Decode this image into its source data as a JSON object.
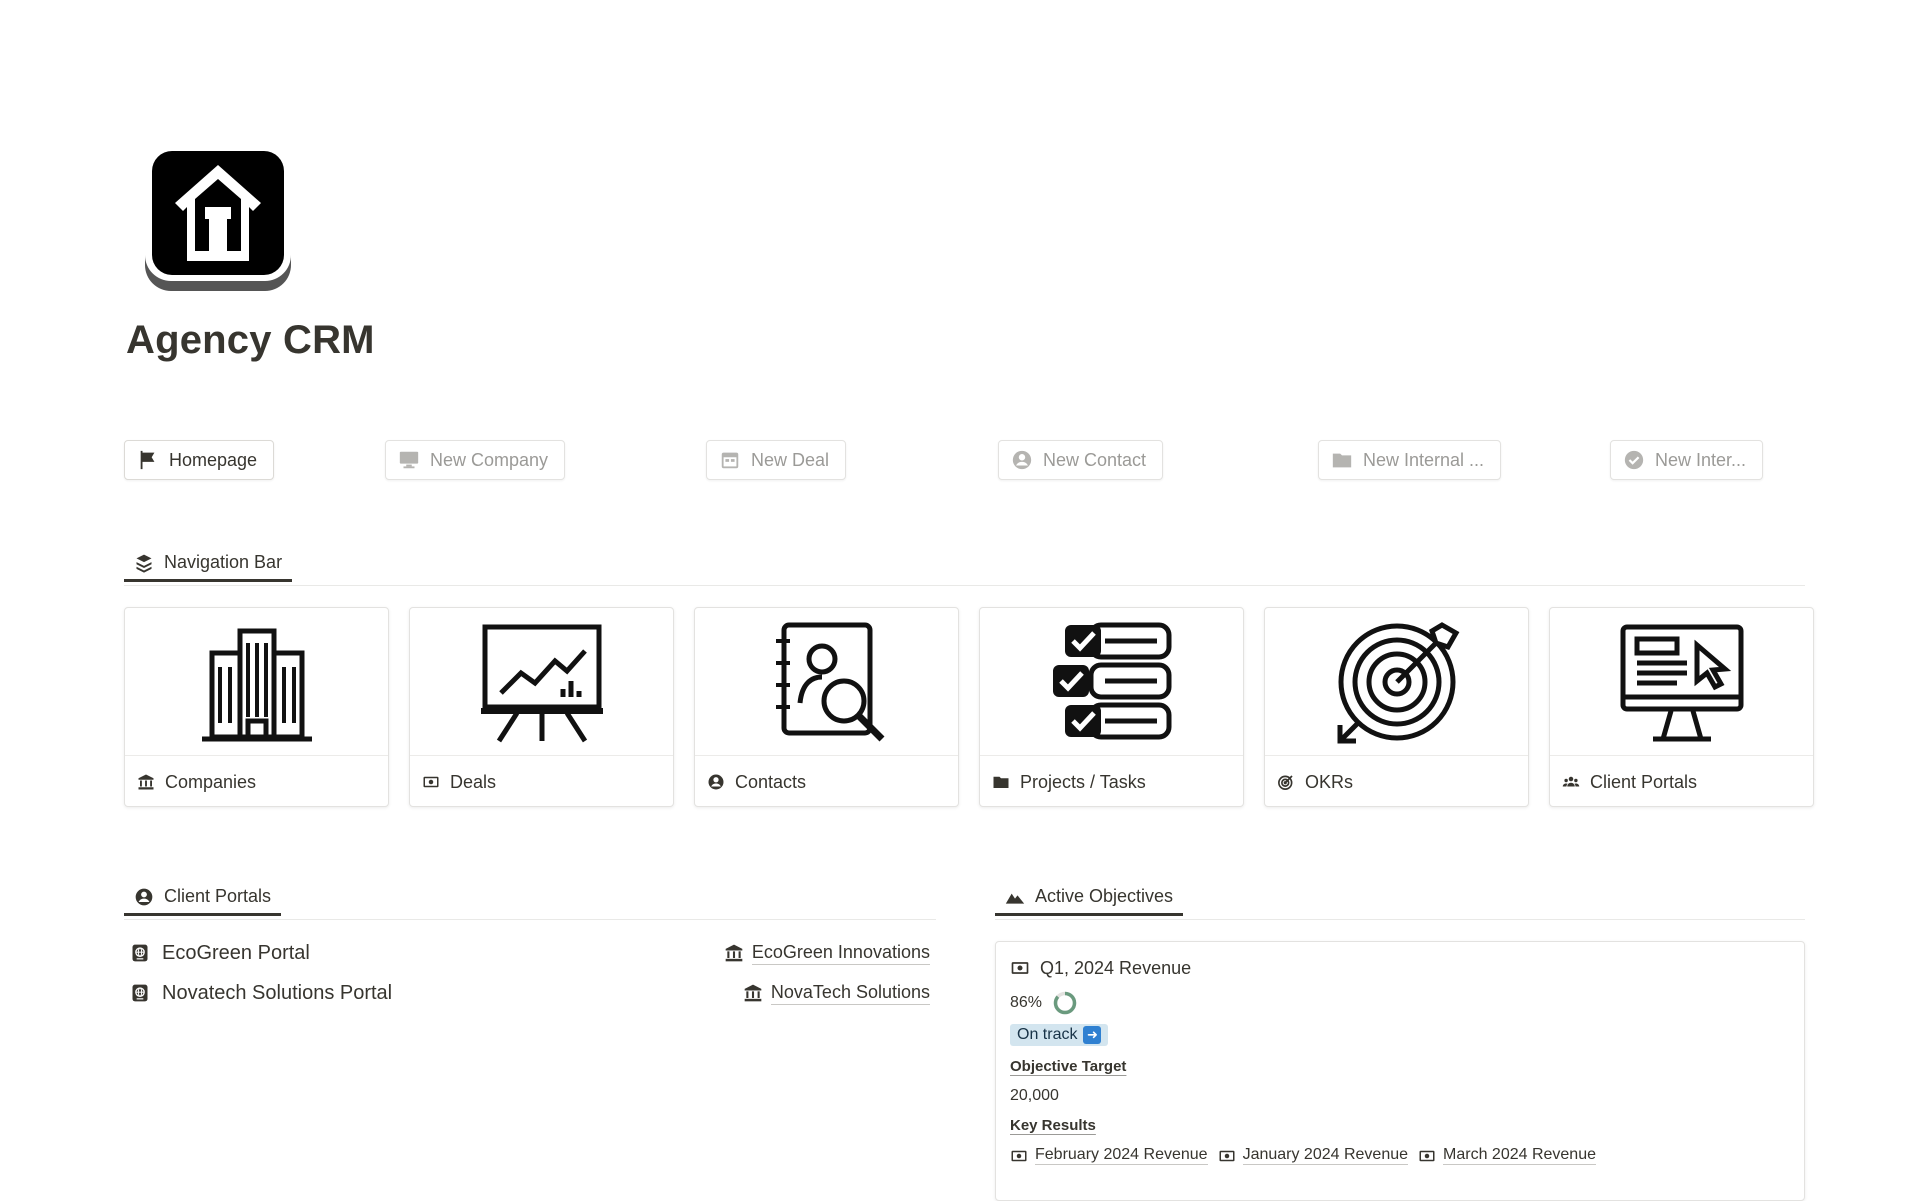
{
  "page": {
    "title": "Agency CRM",
    "icon": "house-icon"
  },
  "buttons": [
    {
      "label": "Homepage",
      "icon": "flag-icon",
      "primary": true
    },
    {
      "label": "New Company",
      "icon": "monitor-icon"
    },
    {
      "label": "New Deal",
      "icon": "calendar-icon"
    },
    {
      "label": "New Contact",
      "icon": "user-circle-icon"
    },
    {
      "label": "New Internal ...",
      "icon": "folder-icon"
    },
    {
      "label": "New Inter...",
      "icon": "check-circle-icon"
    }
  ],
  "navigation": {
    "tab_label": "Navigation Bar",
    "tab_icon": "layers-icon",
    "cards": [
      {
        "label": "Companies",
        "icon": "bank-icon",
        "cover": "buildings-icon"
      },
      {
        "label": "Deals",
        "icon": "money-icon",
        "cover": "chart-board-icon"
      },
      {
        "label": "Contacts",
        "icon": "user-circle-icon",
        "cover": "contact-search-icon"
      },
      {
        "label": "Projects / Tasks",
        "icon": "folder-icon",
        "cover": "checklist-icon"
      },
      {
        "label": "OKRs",
        "icon": "target-icon",
        "cover": "target-arrow-icon"
      },
      {
        "label": "Client Portals",
        "icon": "group-icon",
        "cover": "monitor-cursor-icon"
      }
    ]
  },
  "client_portals": {
    "tab_label": "Client Portals",
    "tab_icon": "user-circle-icon",
    "items": [
      {
        "name": "EcoGreen Portal",
        "company": "EcoGreen Innovations"
      },
      {
        "name": "Novatech Solutions Portal",
        "company": "NovaTech Solutions"
      }
    ]
  },
  "objectives": {
    "tab_label": "Active Objectives",
    "tab_icon": "mountain-icon",
    "card": {
      "title": "Q1, 2024 Revenue",
      "percent": "86%",
      "progress": 0.86,
      "status": "On track",
      "target_label": "Objective Target",
      "target_value": "20,000",
      "key_results_label": "Key Results",
      "key_results": [
        "February 2024 Revenue",
        "January 2024 Revenue",
        "March 2024 Revenue"
      ]
    }
  },
  "colors": {
    "text": "#37352f",
    "muted": "#9b9a97",
    "status_bg": "#d3e5ef",
    "progress": "#6a9a7e"
  }
}
